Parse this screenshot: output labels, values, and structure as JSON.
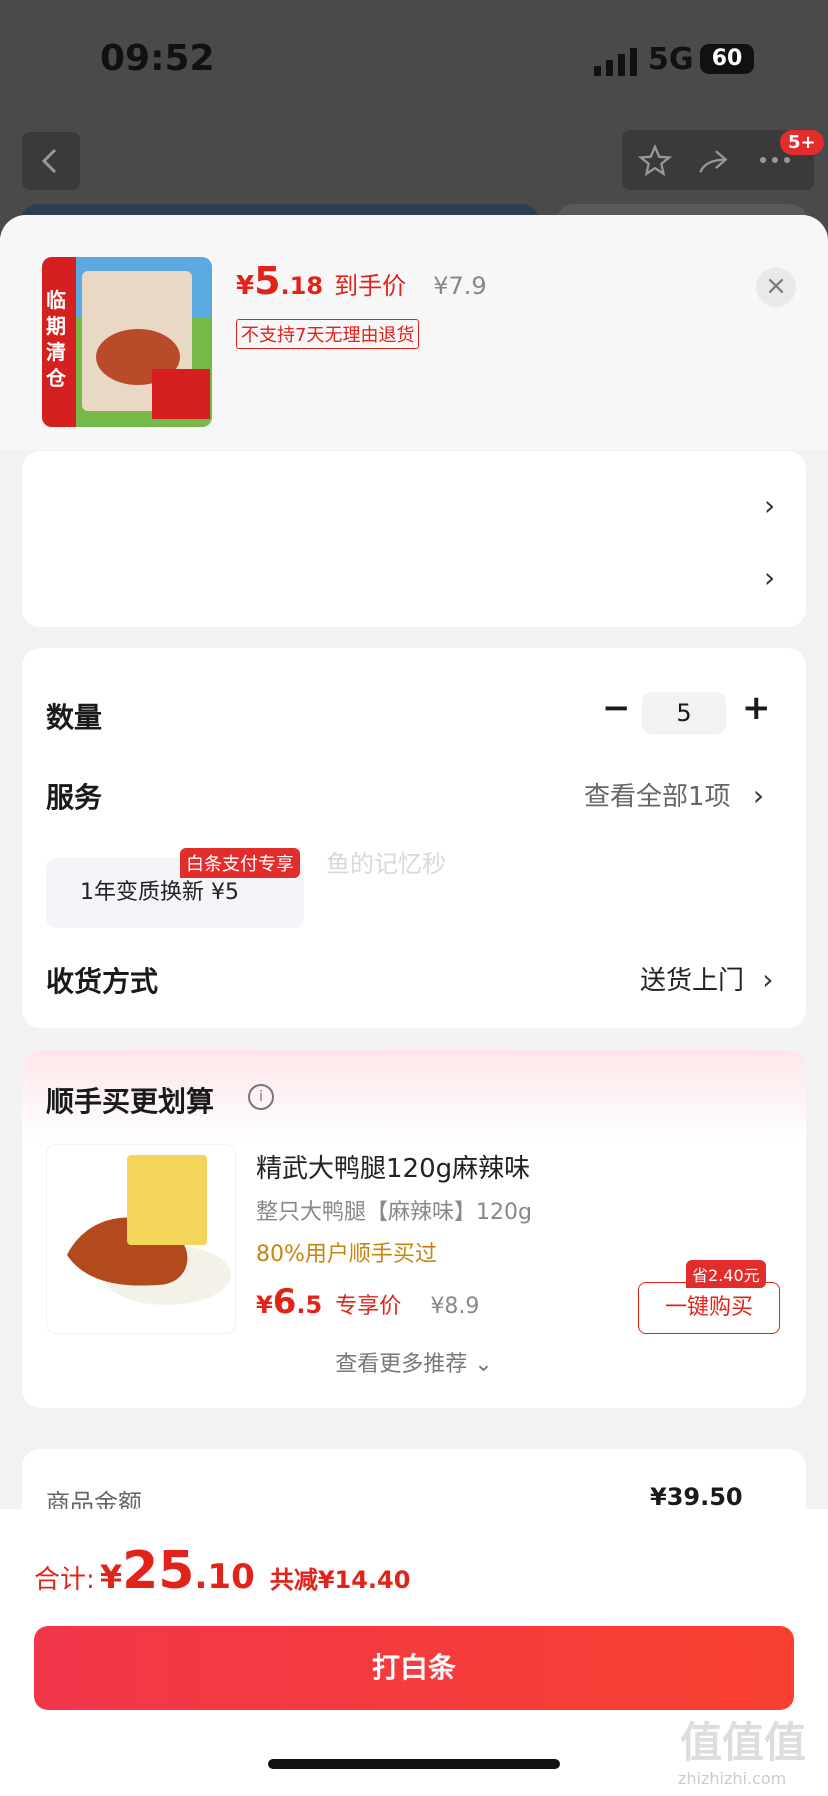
{
  "status_bar": {
    "time": "09:52",
    "network": "5G",
    "battery": "60"
  },
  "nav": {
    "badge": "5+"
  },
  "product": {
    "price_currency": "¥",
    "price_int": "5",
    ".price_dec": ".18",
    "price_dec": ".18",
    "price_label": "到手价",
    "original_price": "¥7.9",
    "tag": "不支持7天无理由退货",
    "thumb_tag": "临期清仓"
  },
  "selectors": {
    "chevron": "›"
  },
  "options": {
    "quantity_label": "数量",
    "quantity_value": "5",
    "service_label": "服务",
    "service_link": "查看全部1项",
    "service_chip": "1年变质换新  ¥5",
    "service_badge": "白条支付专享",
    "delivery_label": "收货方式",
    "delivery_value": "送货上门",
    "watermark": "鱼的记忆秒"
  },
  "recommend": {
    "title": "顺手买更划算",
    "item_name": "精武大鸭腿120g麻辣味",
    "item_sub": "整只大鸭腿【麻辣味】120g",
    "item_stat": "80%用户顺手买过",
    "price_currency": "¥",
    "price_int": "6",
    "price_dec": ".5",
    "price_label": "专享价",
    "orig_price": "¥8.9",
    "buy_label": "一键购买",
    "save_tag": "省2.40元",
    "more_label": "查看更多推荐 ⌄"
  },
  "subtotal": {
    "label": "商品金额",
    "value": "¥39.50"
  },
  "footer": {
    "total_label": "合计:",
    "total_currency": "¥",
    "total_int": "25",
    "total_dec": ".10",
    "discount": "共减¥14.40",
    "pay_label": "打白条",
    "logo": "值值值",
    "logo_sub": "zhizhizhi.com"
  },
  "colors": {
    "accent": "#e2231a",
    "button": "#f2364a"
  }
}
